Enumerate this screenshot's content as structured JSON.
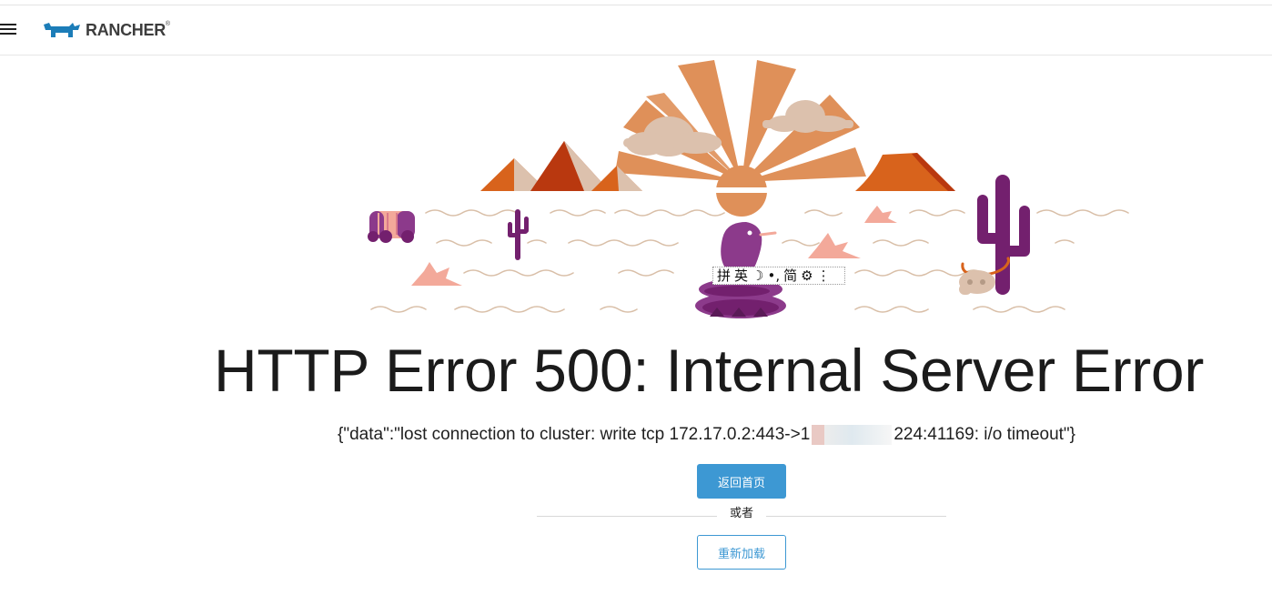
{
  "header": {
    "brand": "RANCHER",
    "brand_mark": "®",
    "menu_icon": "hamburger-menu-icon",
    "logo_icon": "rancher-cow-logo"
  },
  "ime_toolbar": {
    "items": [
      "拼",
      "英",
      "☽",
      "•,",
      "简",
      "⚙",
      "⋮"
    ]
  },
  "error": {
    "title": "HTTP Error 500: Internal Server Error",
    "message_prefix": "{\"data\":\"lost connection to cluster: write tcp 172.17.0.2:443->1",
    "message_suffix": "224:41169: i/o timeout\"}"
  },
  "actions": {
    "home_label": "返回首页",
    "or_label": "或者",
    "reload_label": "重新加载"
  },
  "colors": {
    "primary": "#3d98d3",
    "sun": "#df9059",
    "mountain": "#d8631c",
    "cactus": "#73206e",
    "snake": "#8c3a8b",
    "sand": "#d9bfa8",
    "shrub": "#f3a99a"
  }
}
